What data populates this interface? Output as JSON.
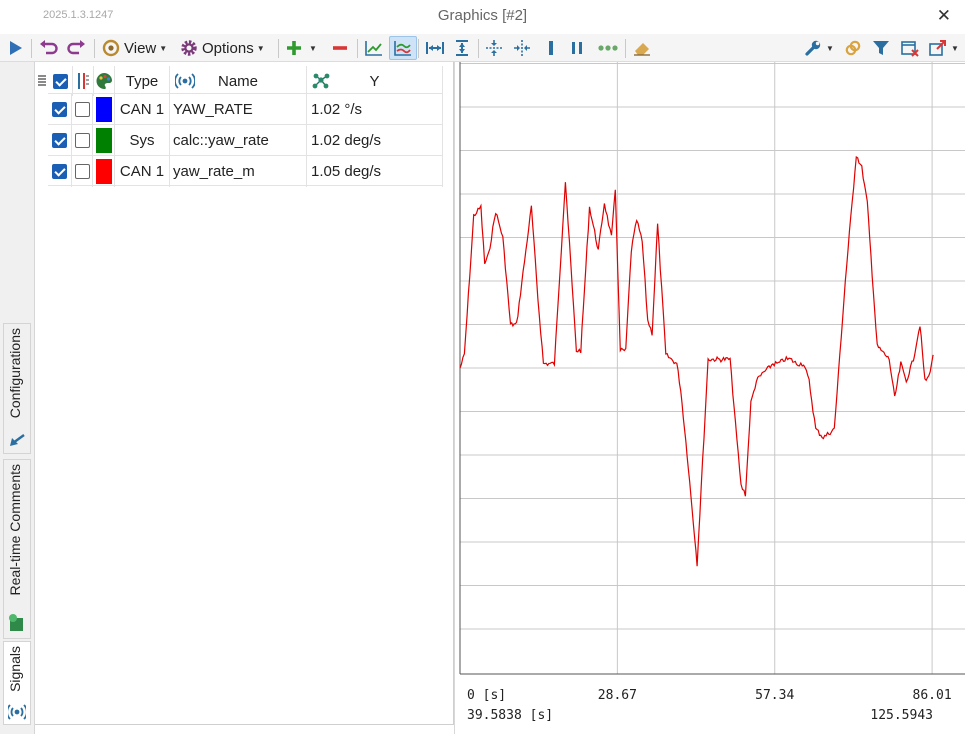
{
  "window": {
    "version": "2025.1.3.1247",
    "title": "Graphics [#2]",
    "close_glyph": "✕"
  },
  "toolbar": {
    "view_label": "View",
    "options_label": "Options",
    "icons": [
      "play-icon",
      "undo-icon",
      "redo-icon",
      "view-icon",
      "gear-icon",
      "plus-icon",
      "minus-icon",
      "line-chart-icon",
      "multi-line-icon",
      "fit-x-icon",
      "fit-y-icon",
      "collapse-v-icon",
      "collapse-h-icon",
      "cursor-1-icon",
      "cursor-2-icon",
      "more-icon",
      "eraser-icon",
      "wrench-icon",
      "link-icon",
      "filter-icon",
      "clear-icon",
      "export-icon"
    ]
  },
  "side_tabs": {
    "configurations": "Configurations",
    "comments": "Real-time Comments",
    "signals": "Signals"
  },
  "signals_grid": {
    "headers": {
      "type": "Type",
      "name": "Name",
      "y": "Y"
    },
    "rows": [
      {
        "type": "CAN 1",
        "name": "YAW_RATE",
        "y": "1.02 °/s",
        "color": "#0000ff",
        "visible": true,
        "selected": false
      },
      {
        "type": "Sys",
        "name": "calc::yaw_rate",
        "y": "1.02 deg/s",
        "color": "#008000",
        "visible": true,
        "selected": false
      },
      {
        "type": "CAN 1",
        "name": "yaw_rate_m",
        "y": "1.05 deg/s",
        "color": "#ff0000",
        "visible": true,
        "selected": false
      }
    ]
  },
  "chart_data": {
    "type": "line",
    "x_ticks": [
      "0 [s]",
      "28.67",
      "57.34",
      "86.01"
    ],
    "x_tick_values": [
      0,
      28.67,
      57.34,
      86.01
    ],
    "xlim": [
      0,
      86.01
    ],
    "cursor_left": "39.5838 [s]",
    "cursor_right": "125.5943",
    "grid": true,
    "series": [
      {
        "name": "yaw_rate_m",
        "color": "#e00000",
        "x": [
          0,
          0.8,
          2.5,
          3.8,
          4.5,
          5.2,
          6.5,
          7.8,
          9.2,
          10.3,
          11.5,
          13.0,
          14.2,
          15.2,
          17.2,
          19.2,
          21.2,
          22.0,
          23.6,
          25.2,
          26.3,
          27.6,
          28.3,
          29.2,
          30.2,
          31.2,
          32.2,
          33.2,
          34.2,
          35.0,
          36.0,
          37.5,
          39.5,
          40.2,
          41.4,
          43.2,
          45.2,
          47.3,
          49.2,
          50.2,
          51.2,
          52.0,
          53.0,
          54.0,
          55.3,
          56.3,
          57.0,
          58.0,
          59.2,
          60.2,
          61.3,
          62.6,
          63.6,
          64.8,
          66.2,
          68.2,
          70.2,
          72.2,
          73.2,
          74.2,
          76.0,
          78.2,
          79.2,
          80.3,
          81.3,
          82.6,
          83.8,
          84.7,
          85.4,
          86.2
        ],
        "y": [
          0.0,
          0.3,
          3.5,
          3.7,
          2.4,
          2.6,
          3.6,
          3.0,
          1.0,
          1.0,
          2.2,
          3.7,
          1.6,
          0.1,
          0.1,
          4.3,
          0.4,
          0.4,
          3.7,
          2.7,
          3.8,
          3.0,
          4.1,
          0.4,
          0.4,
          2.7,
          3.4,
          2.9,
          1.1,
          0.8,
          3.3,
          0.3,
          0.1,
          -0.5,
          -2.0,
          -4.5,
          0.2,
          0.2,
          0.2,
          -1.3,
          -2.7,
          -2.9,
          -0.8,
          -0.3,
          -0.1,
          0.0,
          0.1,
          0.1,
          0.2,
          0.2,
          0.1,
          0.1,
          -0.3,
          -1.4,
          -1.6,
          -1.4,
          2.0,
          4.9,
          4.6,
          3.8,
          0.5,
          0.2,
          -0.7,
          0.1,
          -0.3,
          0.2,
          1.0,
          -0.3,
          -0.2,
          0.3
        ]
      }
    ]
  }
}
